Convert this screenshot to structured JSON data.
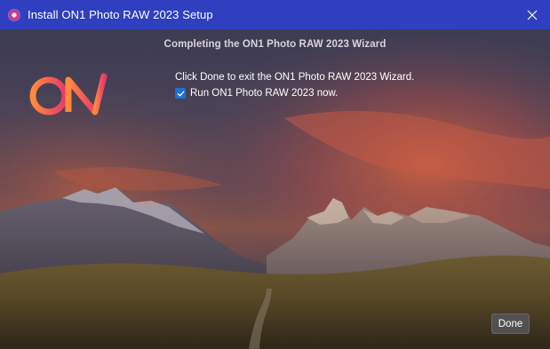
{
  "window": {
    "title": "Install ON1 Photo RAW 2023 Setup",
    "close_label": "✕"
  },
  "wizard": {
    "heading": "Completing the ON1 Photo RAW 2023 Wizard",
    "instructions": "Click Done to exit the ON1 Photo RAW 2023 Wizard.",
    "run_checkbox_label": "Run ON1 Photo RAW 2023 now.",
    "run_checked": true,
    "done_label": "Done"
  },
  "logo": {
    "text": "ON1",
    "gradient_start": "#ff8a3d",
    "gradient_end": "#e83a6a"
  },
  "colors": {
    "titlebar": "#2f3fbf",
    "checkbox_accent": "#1e6fd9"
  },
  "icons": {
    "app": "on1-app-icon",
    "close": "close-icon",
    "check": "checkmark-icon"
  }
}
